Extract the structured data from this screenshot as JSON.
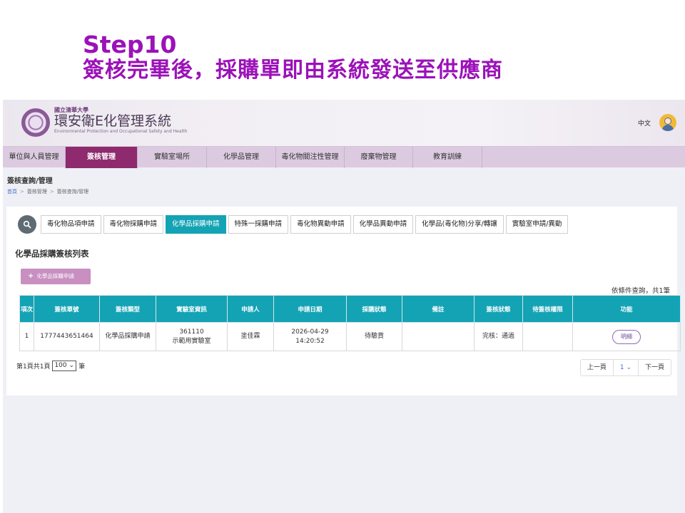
{
  "slide": {
    "step": "Step10",
    "subtitle": "簽核完畢後，採購單即由系統發送至供應商"
  },
  "header": {
    "university": "國立清華大學",
    "system_name": "環安衛E化管理系統",
    "system_subtitle": "Environmental Protection and Occupational Safety and Health",
    "language": "中文"
  },
  "nav": {
    "items": [
      "單位與人員管理",
      "簽核管理",
      "實驗室場所",
      "化學品管理",
      "毒化物關注性管理",
      "廢棄物管理",
      "教育訓練"
    ],
    "active_index": 1
  },
  "page": {
    "title": "簽核查詢/管理",
    "breadcrumb": [
      "首頁",
      "簽核管理",
      "簽核查詢/管理"
    ]
  },
  "tabs": {
    "items": [
      "毒化物品項申請",
      "毒化物採購申請",
      "化學品採購申請",
      "特殊一採購申請",
      "毒化物異動申請",
      "化學品異動申請",
      "化學品(毒化物)分享/轉讓",
      "實驗室申請/異動"
    ],
    "active_index": 2
  },
  "list": {
    "title": "化學品採購簽核列表",
    "add_button": "化學品採購申請",
    "query_info": "依條件查詢，共1筆",
    "headers": [
      "項次",
      "簽核單號",
      "簽核類型",
      "實驗室資訊",
      "申請人",
      "申請日期",
      "採購狀態",
      "備註",
      "簽核狀態",
      "待簽核權限",
      "功能"
    ],
    "rows": [
      {
        "index": "1",
        "sign_no": "1777443651464",
        "sign_type": "化學品採購申請",
        "lab_code": "361110",
        "lab_name": "示範用實驗室",
        "applicant": "塗佳霖",
        "date": "2026-04-29",
        "time": "14:20:52",
        "purchase_status": "待驗貨",
        "note": "",
        "sign_status": "完核：通過",
        "pending_permission": "",
        "action": "明細"
      }
    ]
  },
  "pager": {
    "summary_prefix": "第1頁共1頁",
    "page_size": "100",
    "summary_suffix": "筆",
    "prev": "上一頁",
    "current": "1",
    "next": "下一頁"
  },
  "colors": {
    "title_purple": "#9b12b8",
    "nav_active": "#8e2a6d",
    "teal": "#13a3b4"
  }
}
